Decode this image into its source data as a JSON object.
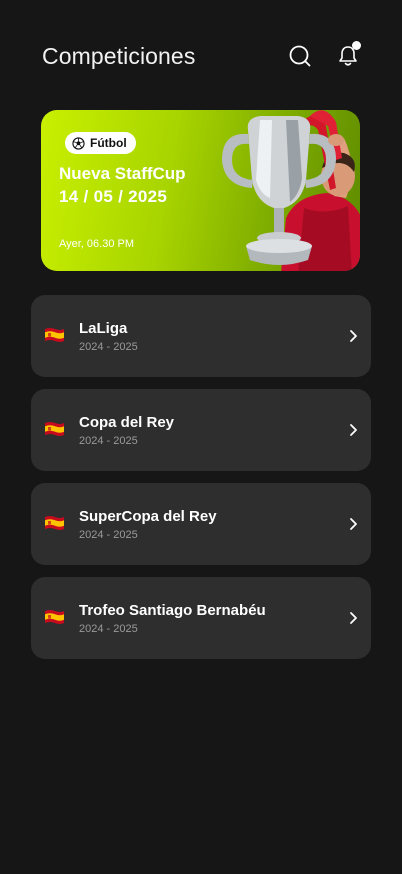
{
  "header": {
    "title": "Competiciones",
    "search_icon": "search-icon",
    "bell_icon": "bell-icon",
    "has_notification": true
  },
  "featured": {
    "category": "Fútbol",
    "category_icon": "soccer-ball-icon",
    "name": "Nueva StaffCup",
    "date": "14 / 05 / 2025",
    "time": "Ayer, 06.30 PM",
    "image": "trophy-player-image",
    "gradient_start": "#c9f000",
    "gradient_end": "#5e8a00"
  },
  "competitions": [
    {
      "name": "LaLiga",
      "season": "2024 - 2025",
      "flag": "spain-flag-icon"
    },
    {
      "name": "Copa del Rey",
      "season": "2024 - 2025",
      "flag": "spain-flag-icon"
    },
    {
      "name": "SuperCopa del Rey",
      "season": "2024 - 2025",
      "flag": "spain-flag-icon"
    },
    {
      "name": "Trofeo Santiago Bernabéu",
      "season": "2024 - 2025",
      "flag": "spain-flag-icon"
    }
  ],
  "colors": {
    "background": "#161616",
    "card": "#2e2e2e",
    "muted_text": "#9a9a9a"
  }
}
